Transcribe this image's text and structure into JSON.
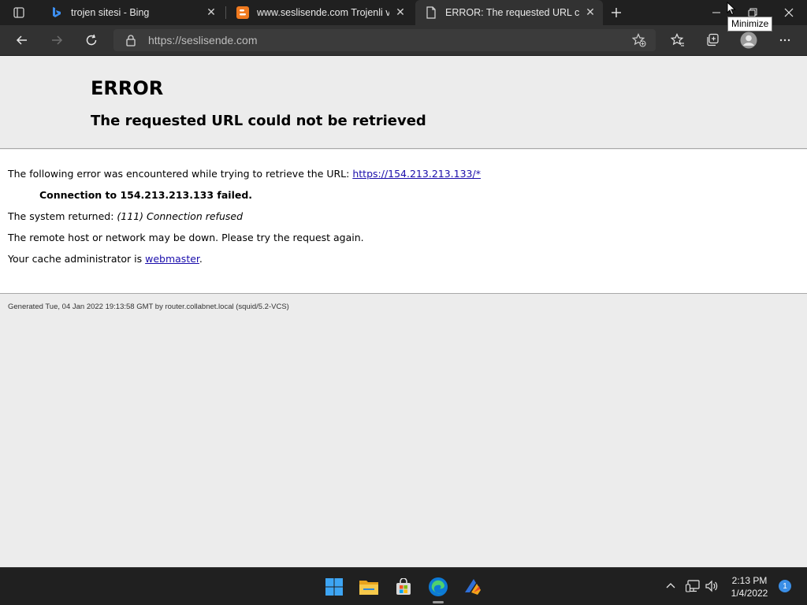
{
  "browser": {
    "tabs": [
      {
        "title": "trojen sitesi - Bing",
        "icon": "bing-icon"
      },
      {
        "title": "www.seslisende.com Trojenli virüs",
        "icon": "blogger-icon"
      },
      {
        "title": "ERROR: The requested URL could not be retrieved",
        "icon": "page-icon"
      }
    ],
    "address": "https://seslisende.com",
    "tooltip": "Minimize"
  },
  "error_page": {
    "title": "ERROR",
    "subtitle": "The requested URL could not be retrieved",
    "encounter_text": "The following error was encountered while trying to retrieve the URL: ",
    "url_link": "https://154.213.213.133/*",
    "failed_text": "Connection to 154.213.213.133 failed.",
    "system_prefix": "The system returned: ",
    "system_detail": "(111) Connection refused",
    "remote_text": "The remote host or network may be down. Please try the request again.",
    "cache_prefix": "Your cache administrator is ",
    "cache_link": "webmaster",
    "cache_suffix": ".",
    "footer": "Generated Tue, 04 Jan 2022 19:13:58 GMT by router.collabnet.local (squid/5.2-VCS)"
  },
  "taskbar": {
    "time": "2:13 PM",
    "date": "1/4/2022",
    "notification_count": "1"
  },
  "colors": {
    "chrome_dark": "#202020",
    "toolbar": "#323232",
    "link": "#1a0dab",
    "accent": "#3a8ee6"
  }
}
